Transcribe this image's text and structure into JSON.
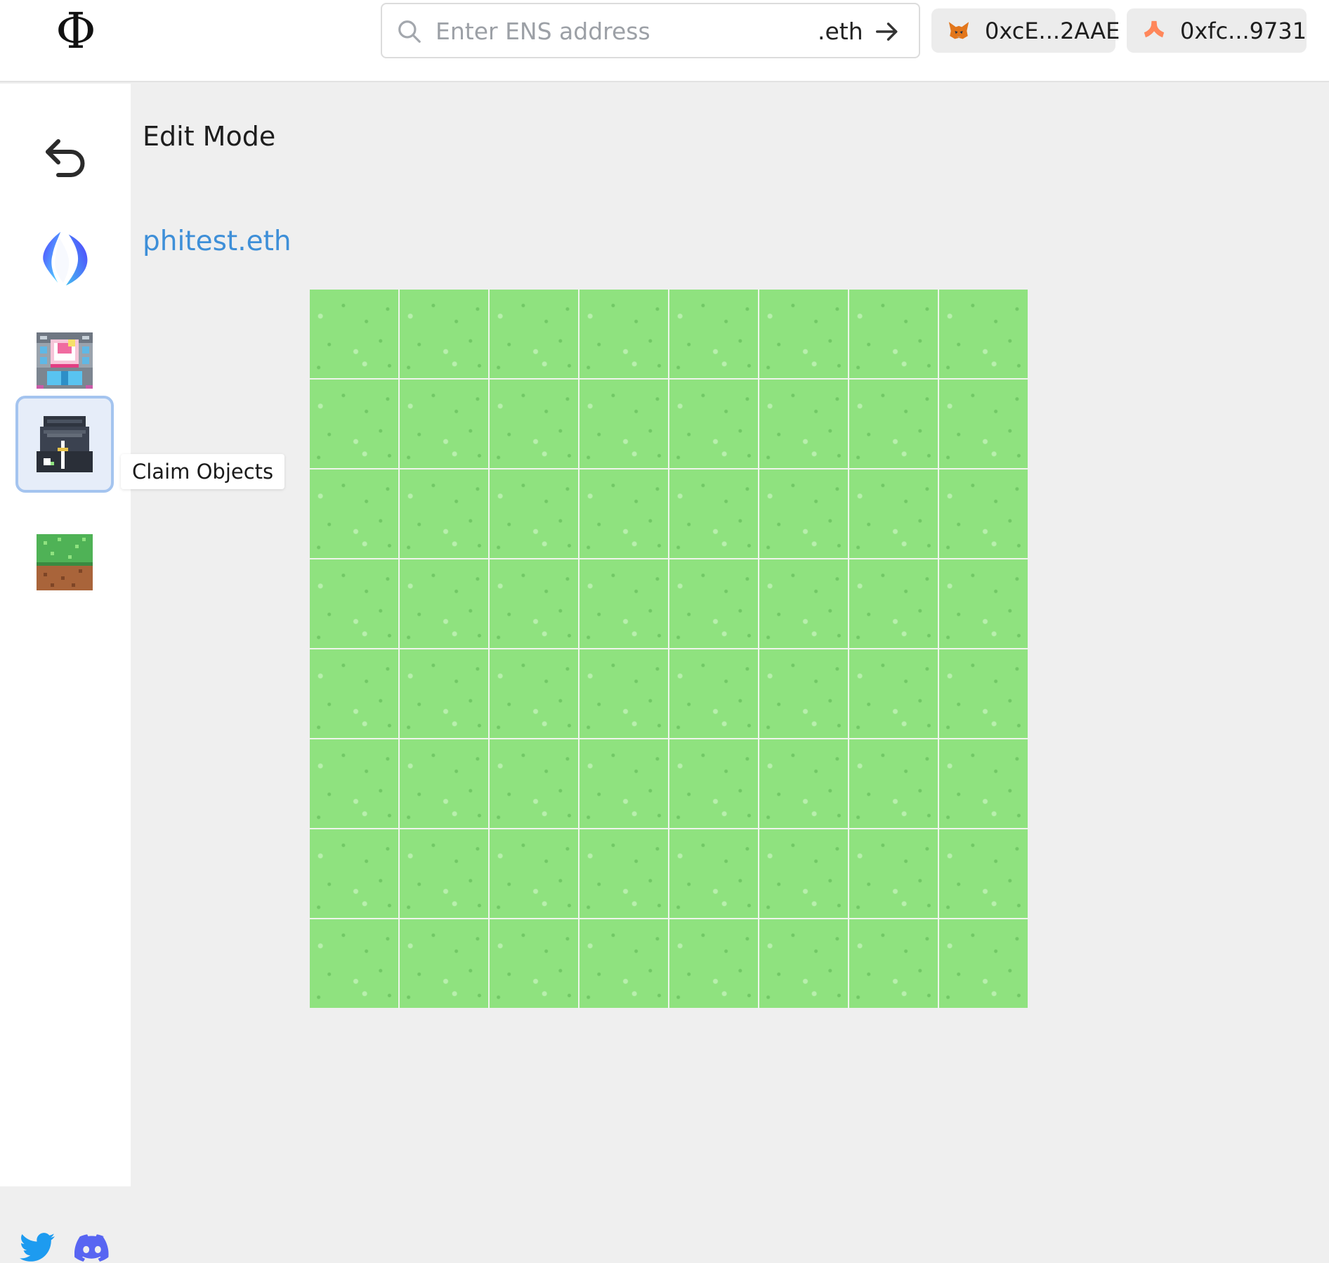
{
  "header": {
    "logo_text": "Φ",
    "search": {
      "placeholder": "Enter ENS address",
      "value": "",
      "suffix": ".eth"
    },
    "wallets": [
      {
        "icon": "metamask-fox-icon",
        "label": "0xcE...2AAE"
      },
      {
        "icon": "argent-wallet-icon",
        "label": "0xfc...9731"
      }
    ]
  },
  "sidebar": {
    "items": [
      {
        "name": "back",
        "icon": "undo-arrow-icon"
      },
      {
        "name": "ens",
        "icon": "ens-logo-icon"
      },
      {
        "name": "objects",
        "icon": "unicorn-hotel-icon"
      },
      {
        "name": "claim-objects",
        "icon": "loot-chest-icon",
        "tooltip": "Claim Objects",
        "active": true
      },
      {
        "name": "tiles",
        "icon": "grass-tile-icon"
      }
    ],
    "social": [
      {
        "icon": "twitter-icon"
      },
      {
        "icon": "discord-icon"
      }
    ]
  },
  "main": {
    "mode_title": "Edit Mode",
    "ens_name": "phitest.eth",
    "land": {
      "rows": 8,
      "cols": 8,
      "tile": "grass"
    }
  },
  "colors": {
    "accent_link": "#3e8fd8",
    "grass": "#8fe27f",
    "active_border": "#a4c4ef"
  }
}
